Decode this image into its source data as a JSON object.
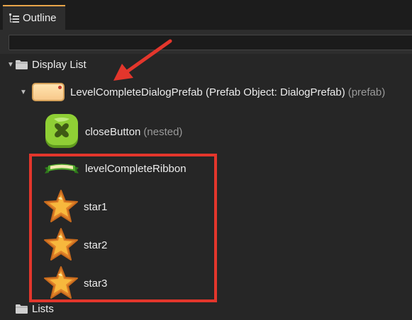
{
  "tab": {
    "title": "Outline",
    "icon": "outline-icon"
  },
  "filter": {
    "value": "",
    "placeholder": ""
  },
  "tree": {
    "display_list": {
      "label": "Display List",
      "icon": "folder-icon"
    },
    "prefab": {
      "name": "LevelCompleteDialogPrefab (Prefab Object: DialogPrefab)",
      "tag": "(prefab)",
      "icon": "prefab-thumbnail-icon"
    },
    "children": [
      {
        "name": "closeButton",
        "tag": "(nested)",
        "icon": "close-button-icon"
      },
      {
        "name": "levelCompleteRibbon",
        "tag": "",
        "icon": "ribbon-icon"
      },
      {
        "name": "star1",
        "tag": "",
        "icon": "star-icon"
      },
      {
        "name": "star2",
        "tag": "",
        "icon": "star-icon"
      },
      {
        "name": "star3",
        "tag": "",
        "icon": "star-icon"
      }
    ],
    "lists": {
      "label": "Lists",
      "icon": "folder-icon"
    }
  },
  "colors": {
    "accent": "#e9a64a",
    "annotation": "#e3362c",
    "background": "#262626"
  }
}
